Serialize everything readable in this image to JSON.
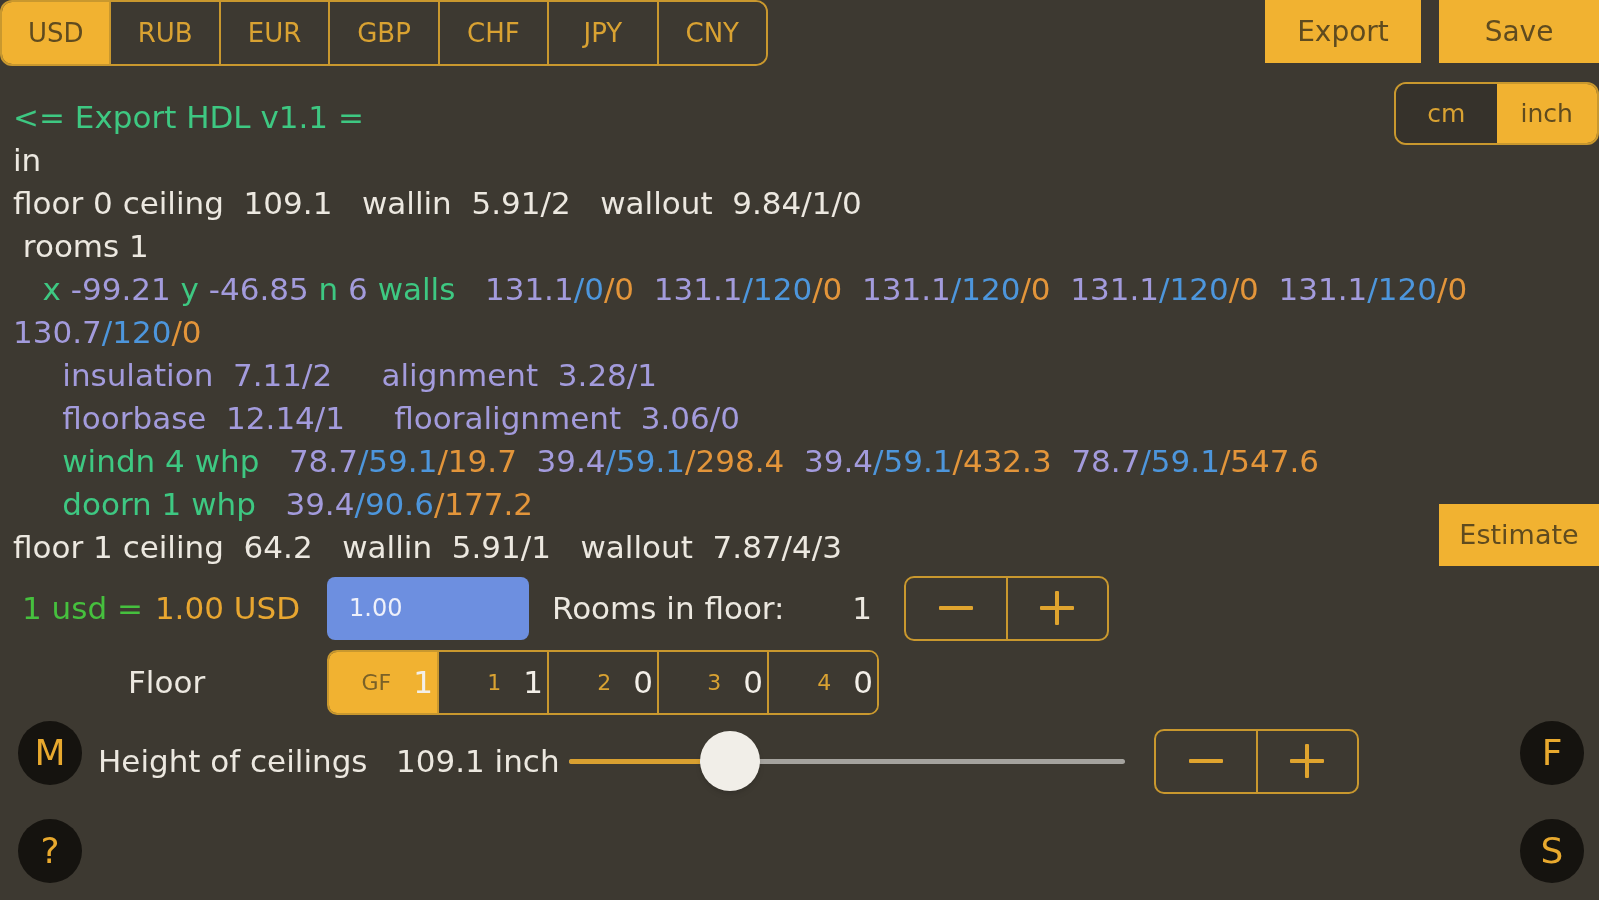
{
  "currency_tabs": [
    {
      "label": "USD",
      "selected": true
    },
    {
      "label": "RUB",
      "selected": false
    },
    {
      "label": "EUR",
      "selected": false
    },
    {
      "label": "GBP",
      "selected": false
    },
    {
      "label": "CHF",
      "selected": false
    },
    {
      "label": "JPY",
      "selected": false
    },
    {
      "label": "CNY",
      "selected": false
    }
  ],
  "toolbar_buttons": [
    "Export",
    "Save"
  ],
  "unit_toggle": [
    {
      "label": "cm",
      "selected": false
    },
    {
      "label": "inch",
      "selected": true
    }
  ],
  "code_lines": [
    {
      "segments": [
        {
          "text": "<= Export HDL v1.1 =",
          "color": "#3ec882"
        }
      ]
    },
    {
      "segments": [
        {
          "text": "in",
          "color": "#ece8e0"
        }
      ]
    },
    {
      "segments": [
        {
          "text": "floor 0 ceiling  109.1   wallin  5.91/2   wallout  9.84/1/0",
          "color": "#ece8e0"
        }
      ]
    },
    {
      "segments": [
        {
          "text": " rooms 1",
          "color": "#ece8e0"
        }
      ]
    },
    {
      "segments": [
        {
          "text": "   x ",
          "color": "#3ec882"
        },
        {
          "text": "-99.21",
          "color": "#a39bdc"
        },
        {
          "text": " y ",
          "color": "#3ec882"
        },
        {
          "text": "-46.85",
          "color": "#a39bdc"
        },
        {
          "text": " n ",
          "color": "#3ec882"
        },
        {
          "text": "6",
          "color": "#a39bdc"
        },
        {
          "text": " walls",
          "color": "#3ec882"
        },
        {
          "text": "   131.1",
          "color": "#a39bdc"
        },
        {
          "text": "/0",
          "color": "#4d96dc"
        },
        {
          "text": "/0",
          "color": "#e3953a"
        },
        {
          "text": "  131.1",
          "color": "#a39bdc"
        },
        {
          "text": "/120",
          "color": "#4d96dc"
        },
        {
          "text": "/0",
          "color": "#e3953a"
        },
        {
          "text": "  131.1",
          "color": "#a39bdc"
        },
        {
          "text": "/120",
          "color": "#4d96dc"
        },
        {
          "text": "/0",
          "color": "#e3953a"
        },
        {
          "text": "  131.1",
          "color": "#a39bdc"
        },
        {
          "text": "/120",
          "color": "#4d96dc"
        },
        {
          "text": "/0",
          "color": "#e3953a"
        },
        {
          "text": "  131.1",
          "color": "#a39bdc"
        },
        {
          "text": "/120",
          "color": "#4d96dc"
        },
        {
          "text": "/0",
          "color": "#e3953a"
        }
      ]
    },
    {
      "segments": [
        {
          "text": "130.7",
          "color": "#a39bdc"
        },
        {
          "text": "/120",
          "color": "#4d96dc"
        },
        {
          "text": "/0",
          "color": "#e3953a"
        }
      ]
    },
    {
      "segments": [
        {
          "text": "     insulation  7.11/2     alignment  3.28/1",
          "color": "#a39bdc"
        }
      ]
    },
    {
      "segments": [
        {
          "text": "     floorbase  12.14/1     flooralignment  3.06/0",
          "color": "#a39bdc"
        }
      ]
    },
    {
      "segments": [
        {
          "text": "     windn 4 whp",
          "color": "#3ec882"
        },
        {
          "text": "   78.7",
          "color": "#a39bdc"
        },
        {
          "text": "/59.1",
          "color": "#4d96dc"
        },
        {
          "text": "/19.7",
          "color": "#e3953a"
        },
        {
          "text": "  39.4",
          "color": "#a39bdc"
        },
        {
          "text": "/59.1",
          "color": "#4d96dc"
        },
        {
          "text": "/298.4",
          "color": "#e3953a"
        },
        {
          "text": "  39.4",
          "color": "#a39bdc"
        },
        {
          "text": "/59.1",
          "color": "#4d96dc"
        },
        {
          "text": "/432.3",
          "color": "#e3953a"
        },
        {
          "text": "  78.7",
          "color": "#a39bdc"
        },
        {
          "text": "/59.1",
          "color": "#4d96dc"
        },
        {
          "text": "/547.6",
          "color": "#e3953a"
        }
      ]
    },
    {
      "segments": [
        {
          "text": "     doorn 1 whp",
          "color": "#3ec882"
        },
        {
          "text": "   39.4",
          "color": "#a39bdc"
        },
        {
          "text": "/90.6",
          "color": "#4d96dc"
        },
        {
          "text": "/177.2",
          "color": "#e3953a"
        }
      ]
    },
    {
      "segments": [
        {
          "text": "floor 1 ceiling  64.2   wallin  5.91/1   wallout  7.87/4/3",
          "color": "#ece8e0"
        }
      ]
    }
  ],
  "estimate_button": "Estimate",
  "rate": {
    "label": "1 usd =",
    "value": "1.00 USD",
    "input": "1.00"
  },
  "rooms_in_floor": {
    "label": "Rooms in floor:",
    "value": "1"
  },
  "floor": {
    "label": "Floor",
    "segments": [
      {
        "label": "GF",
        "count": "1",
        "selected": true
      },
      {
        "label": "1",
        "count": "1",
        "selected": false
      },
      {
        "label": "2",
        "count": "0",
        "selected": false
      },
      {
        "label": "3",
        "count": "0",
        "selected": false
      },
      {
        "label": "4",
        "count": "0",
        "selected": false
      }
    ]
  },
  "ceiling_height": {
    "left_button": "M",
    "label": "Height of ceilings",
    "reading": "109.1 inch",
    "level": 0.29,
    "right_button": "F"
  },
  "bottom_row": {
    "left_button": "?",
    "right_button": "S"
  }
}
